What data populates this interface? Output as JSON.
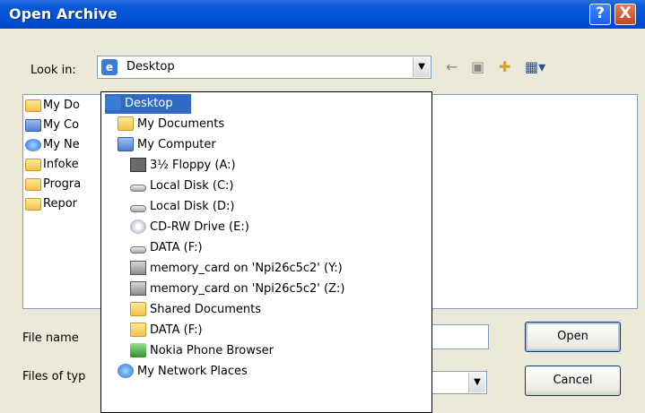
{
  "window": {
    "title": "Open Archive",
    "help_label": "?",
    "close_label": "X"
  },
  "lookin": {
    "label": "Look in:",
    "value": "Desktop"
  },
  "file_list": [
    {
      "label": "My Do",
      "icon": "folder-icon"
    },
    {
      "label": "My Co",
      "icon": "computer-icon"
    },
    {
      "label": "My Ne",
      "icon": "network-icon"
    },
    {
      "label": "Infoke",
      "icon": "folder-icon"
    },
    {
      "label": "Progra",
      "icon": "folder-icon"
    },
    {
      "label": "Repor",
      "icon": "folder-icon"
    }
  ],
  "dropdown": {
    "items": [
      {
        "label": "Desktop",
        "icon": "desktop-icon",
        "selected": true
      },
      {
        "label": "My Documents",
        "icon": "folder-icon"
      },
      {
        "label": "My Computer",
        "icon": "computer-icon"
      },
      {
        "label": "3½ Floppy (A:)",
        "icon": "floppy-icon"
      },
      {
        "label": "Local Disk (C:)",
        "icon": "disk-icon"
      },
      {
        "label": "Local Disk (D:)",
        "icon": "disk-icon"
      },
      {
        "label": "CD-RW Drive (E:)",
        "icon": "cd-icon"
      },
      {
        "label": "DATA (F:)",
        "icon": "disk-icon"
      },
      {
        "label": "memory_card on 'Npi26c5c2' (Y:)",
        "icon": "network-drive-icon"
      },
      {
        "label": "memory_card on 'Npi26c5c2' (Z:)",
        "icon": "network-drive-icon"
      },
      {
        "label": "Shared Documents",
        "icon": "folder-icon"
      },
      {
        "label": "DATA (F:)",
        "icon": "folder-icon"
      },
      {
        "label": "Nokia Phone Browser",
        "icon": "nokia-icon"
      },
      {
        "label": "My Network Places",
        "icon": "network-icon"
      }
    ]
  },
  "filename": {
    "label": "File name",
    "value": ""
  },
  "filetype": {
    "label": "Files of typ",
    "value": ""
  },
  "buttons": {
    "open": "Open",
    "cancel": "Cancel"
  }
}
